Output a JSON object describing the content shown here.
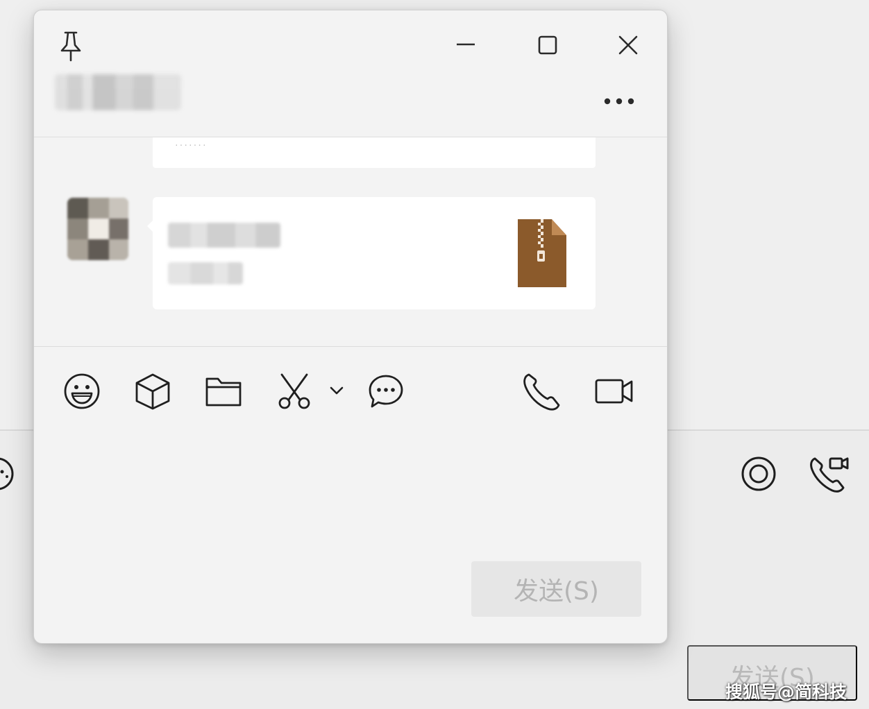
{
  "background_window": {
    "send_label": "发送(S)",
    "icons": [
      "emoji-icon",
      "record-icon",
      "video-call-icon"
    ]
  },
  "popup": {
    "title": "",
    "header_icons": [
      "pin-icon",
      "minimize-icon",
      "maximize-icon",
      "close-icon",
      "more-icon"
    ],
    "messages": [
      {
        "type": "text",
        "partial": true
      },
      {
        "type": "file",
        "file_icon": "zip-archive-icon",
        "accent": "#8b5a2b"
      }
    ],
    "toolbar": {
      "left_icons": [
        "emoji-icon",
        "sticker-icon",
        "folder-icon",
        "scissors-icon",
        "chevron-down-icon",
        "chat-bubble-icon"
      ],
      "right_icons": [
        "phone-icon",
        "video-icon"
      ]
    },
    "send_label": "发送(S)"
  },
  "watermark": "搜狐号@简科技"
}
